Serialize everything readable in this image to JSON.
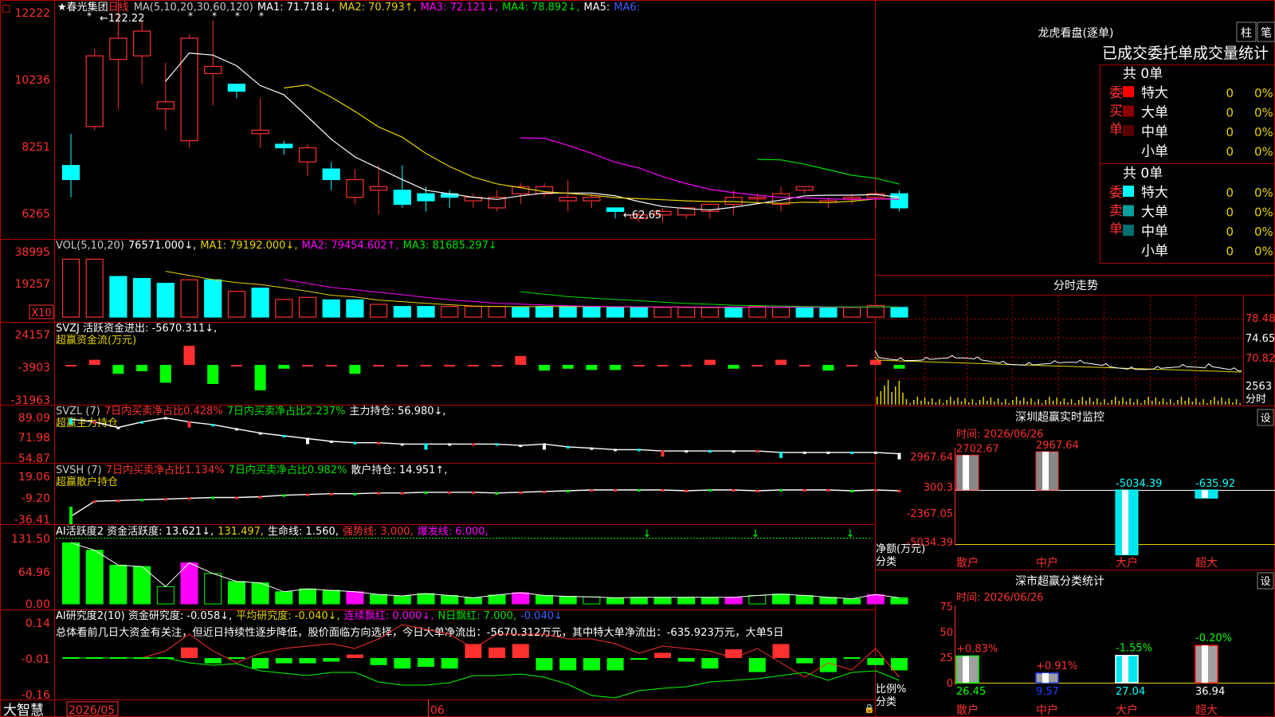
{
  "stock": {
    "name": "春光集团",
    "period": "日线",
    "peak_label": "122.22",
    "low_label": "62.65"
  },
  "brand": "大智慧",
  "date_left": "2026/05",
  "date_mid": "06",
  "colors": {
    "up": "#ff3030",
    "down": "#00ffff",
    "ma1": "#ffffff",
    "ma2": "#e6d200",
    "ma3": "#ff00ff",
    "ma4": "#00e000",
    "green": "#00ff00",
    "grid": "#b00000"
  },
  "price_panel": {
    "header": [
      {
        "t": "MA(5,10,20,30,60,120)",
        "c": "#c8c8c8"
      },
      {
        "t": "MA1: 71.718↓,",
        "c": "#ffffff"
      },
      {
        "t": "MA2: 70.793↑,",
        "c": "#e6d200"
      },
      {
        "t": "MA3: 72.121↓,",
        "c": "#ff00ff"
      },
      {
        "t": "MA4: 78.892↓,",
        "c": "#00e000"
      },
      {
        "t": "MA5:",
        "c": "#ffffff"
      },
      {
        "t": "MA6:",
        "c": "#4060ff"
      }
    ],
    "axis": [
      "12222",
      "10236",
      "8251",
      "6265"
    ]
  },
  "vol_panel": {
    "header": [
      {
        "t": "VOL(5,10,20)",
        "c": "#c8c8c8"
      },
      {
        "t": "76571.000↓,",
        "c": "#ffffff"
      },
      {
        "t": "MA1: 79192.000↓,",
        "c": "#e6d200"
      },
      {
        "t": "MA2: 79454.602↑,",
        "c": "#ff00ff"
      },
      {
        "t": "MA3: 81685.297↓",
        "c": "#00e000"
      }
    ],
    "axis": [
      "38995",
      "19257"
    ],
    "unit": "X10"
  },
  "svzj_panel": {
    "header": [
      {
        "t": "SVZJ  活跃资金进出: -5670.311↓,",
        "c": "#ffffff"
      }
    ],
    "sub": "超赢资金流(万元)",
    "axis": [
      "24157",
      "-3903",
      "-31963"
    ]
  },
  "svzl_panel": {
    "header": [
      {
        "t": "SVZL (7)",
        "c": "#c8c8c8"
      },
      {
        "t": "7日内买卖净占比0.428%",
        "c": "#ff3030"
      },
      {
        "t": "7日内买卖净占比2.237%",
        "c": "#00e000"
      },
      {
        "t": "主力持仓: 56.980↓,",
        "c": "#ffffff"
      }
    ],
    "sub": "超赢主力持仓",
    "axis": [
      "89.09",
      "71.98",
      "54.87"
    ]
  },
  "svsh_panel": {
    "header": [
      {
        "t": "SVSH (7)",
        "c": "#c8c8c8"
      },
      {
        "t": "7日内买卖净占比1.134%",
        "c": "#ff3030"
      },
      {
        "t": "7日内买卖净占比0.982%",
        "c": "#00e000"
      },
      {
        "t": "散户持仓: 14.951↑,",
        "c": "#ffffff"
      }
    ],
    "sub": "超赢散户持仓",
    "axis": [
      "19.06",
      "-9.20",
      "-36.41"
    ]
  },
  "ai_active_panel": {
    "header": [
      {
        "t": "AI活跃度2 资金活跃度: 13.621↓,",
        "c": "#ffffff"
      },
      {
        "t": "131.497,",
        "c": "#e6d200"
      },
      {
        "t": "生命线: 1.560,",
        "c": "#ffffff"
      },
      {
        "t": "强势线: 3.000,",
        "c": "#ff3030"
      },
      {
        "t": "爆发线: 6.000,",
        "c": "#ff00ff"
      }
    ],
    "axis": [
      "131.50",
      "64.96",
      "0.00"
    ]
  },
  "ai_research_panel": {
    "header": [
      {
        "t": "AI研究度2(10) 资金研究度: -0.058↓,",
        "c": "#ffffff"
      },
      {
        "t": "平均研究度: -0.040↓,",
        "c": "#e6d200"
      },
      {
        "t": "连续飘红: 0.000↓,",
        "c": "#ff00ff"
      },
      {
        "t": "N日飘红: 7.000,",
        "c": "#00e000"
      },
      {
        "t": "-0.040↓",
        "c": "#4060ff"
      }
    ],
    "summary": "总体看前几日大资金有关注，但近日持续性逐步降低，股价面临方向选择，今日大单净流出：-5670.312万元，其中特大单净流出：-635.923万元，大单5日",
    "axis": [
      "0.14",
      "-0.01",
      "-0.16"
    ]
  },
  "right_panel": {
    "title": "龙虎看盘(逐单)",
    "btn1": "柱",
    "btn2": "笔",
    "stats_title": "已成交委托单成交量统计",
    "buy_label": "委买单",
    "sell_label": "委卖单",
    "buy_total": "共 0单",
    "sell_total": "共 0单",
    "buy_rows": [
      {
        "name": "特大",
        "count": "0",
        "pct": "0%",
        "color": "#ff0000"
      },
      {
        "name": "大单",
        "count": "0",
        "pct": "0%",
        "color": "#8b0000"
      },
      {
        "name": "中单",
        "count": "0",
        "pct": "0%",
        "color": "#5a0000"
      },
      {
        "name": "小单",
        "count": "0",
        "pct": "0%",
        "color": "#000000"
      }
    ],
    "sell_rows": [
      {
        "name": "特大",
        "count": "0",
        "pct": "0%",
        "color": "#00ffff"
      },
      {
        "name": "大单",
        "count": "0",
        "pct": "0%",
        "color": "#00a0a0"
      },
      {
        "name": "中单",
        "count": "0",
        "pct": "0%",
        "color": "#007070"
      },
      {
        "name": "小单",
        "count": "0",
        "pct": "0%",
        "color": "#000000"
      }
    ],
    "intraday_title": "分时走势",
    "intraday_axis": [
      "78.48",
      "74.65",
      "70.82",
      "2563"
    ],
    "intraday_unit": "分时",
    "monitor_title": "深圳超赢实时监控",
    "set_label": "设",
    "date_label": "时间: 2026/06/26",
    "monitor_axis": [
      "2967.64",
      "300.3",
      "-2367.05",
      "-5034.39"
    ],
    "net_label": "净额(万元)",
    "cat_label": "分类",
    "categories": [
      "散户",
      "中户",
      "大户",
      "超大"
    ],
    "classify_title": "深市超赢分类统计",
    "classify_axis": [
      "75",
      "50",
      "25",
      "0"
    ],
    "ratio_label": "比例%"
  },
  "chart_data": [
    {
      "type": "candlestick",
      "title": "春光集团 日线",
      "candles": [
        [
          79,
          75,
          70,
          88
        ],
        [
          90,
          110,
          89,
          112
        ],
        [
          109,
          115,
          95,
          130
        ],
        [
          110,
          117,
          102,
          120
        ],
        [
          95,
          97,
          108,
          89
        ],
        [
          86,
          115,
          84,
          116
        ],
        [
          105,
          107,
          120,
          96
        ],
        [
          102,
          100,
          102,
          98
        ],
        [
          88,
          89,
          98,
          84
        ],
        [
          85,
          84,
          86,
          82
        ],
        [
          80,
          84,
          85,
          76
        ],
        [
          78,
          75,
          80,
          72
        ],
        [
          70,
          75,
          68,
          78
        ],
        [
          72,
          73,
          79,
          65
        ],
        [
          72,
          68,
          79,
          67
        ],
        [
          71,
          69,
          73,
          66
        ],
        [
          71,
          70,
          72,
          67
        ],
        [
          69,
          70,
          71,
          67
        ],
        [
          67,
          70,
          72,
          66
        ],
        [
          71,
          73,
          74,
          68
        ],
        [
          71,
          73,
          74,
          70
        ],
        [
          69,
          70,
          75,
          66
        ],
        [
          69,
          70,
          71,
          67
        ],
        [
          67,
          66,
          67,
          64
        ],
        [
          64,
          65,
          66,
          63
        ],
        [
          65,
          66,
          67,
          63
        ],
        [
          65,
          67,
          67,
          64
        ],
        [
          66,
          68,
          68,
          64
        ],
        [
          68,
          70,
          72,
          65
        ],
        [
          70,
          70,
          71,
          68
        ],
        [
          68,
          71,
          73,
          66
        ],
        [
          72,
          73,
          73,
          71
        ],
        [
          69,
          69,
          70,
          67
        ],
        [
          70,
          70,
          71,
          68
        ],
        [
          70,
          71,
          72,
          67
        ],
        [
          71,
          67,
          72,
          66
        ]
      ],
      "ylim": [
        60,
        124
      ]
    },
    {
      "type": "bar",
      "title": "VOL",
      "values": [
        300,
        300,
        210,
        200,
        175,
        193,
        193,
        133,
        150,
        91,
        102,
        89,
        89,
        66,
        55,
        55,
        55,
        55,
        55,
        50,
        55,
        55,
        55,
        50,
        50,
        50,
        50,
        50,
        50,
        55,
        50,
        50,
        50,
        50,
        60,
        50
      ],
      "up": [
        1,
        1,
        0,
        0,
        0,
        1,
        0,
        1,
        0,
        1,
        1,
        0,
        0,
        1,
        0,
        0,
        1,
        1,
        1,
        0,
        0,
        0,
        0,
        0,
        0,
        1,
        1,
        1,
        0,
        1,
        1,
        0,
        0,
        1,
        1,
        0
      ],
      "ylim": [
        0,
        330
      ]
    },
    {
      "type": "bar",
      "title": "SVZJ",
      "values": [
        0,
        8000,
        -14000,
        -10000,
        -28000,
        30000,
        -30000,
        0,
        -40000,
        -6000,
        0,
        0,
        -14000,
        0,
        0,
        0,
        0,
        0,
        0,
        14000,
        -9000,
        -6000,
        -8000,
        -8000,
        0,
        0,
        0,
        8000,
        -6000,
        0,
        8000,
        0,
        -9000,
        0,
        8000,
        -6000
      ],
      "ylim": [
        -31963,
        24157
      ]
    },
    {
      "type": "line",
      "title": "AI活跃度2",
      "values": [
        131,
        115,
        83,
        80,
        37,
        88,
        65,
        48,
        45,
        26,
        32,
        29,
        26,
        20,
        17,
        22,
        18,
        13,
        19,
        24,
        18,
        16,
        15,
        13,
        14,
        14,
        14,
        14,
        14,
        18,
        21,
        18,
        14,
        11,
        20,
        13
      ],
      "ylim": [
        0,
        140
      ]
    },
    {
      "type": "bar",
      "title": "深圳超赢实时监控",
      "categories": [
        "散户",
        "中户",
        "大户",
        "超大"
      ],
      "values": [
        2702.67,
        2967.64,
        -5034.39,
        -635.92
      ],
      "ylim": [
        -5034.39,
        2967.64
      ]
    },
    {
      "type": "bar",
      "title": "深市超赢分类统计",
      "categories": [
        "散户",
        "中户",
        "大户",
        "超大"
      ],
      "values": [
        26.45,
        9.57,
        27.04,
        36.94
      ],
      "change": [
        "+0.83%",
        "+0.91%",
        "-1.55%",
        "-0.20%"
      ],
      "ylim": [
        0,
        75
      ]
    }
  ]
}
